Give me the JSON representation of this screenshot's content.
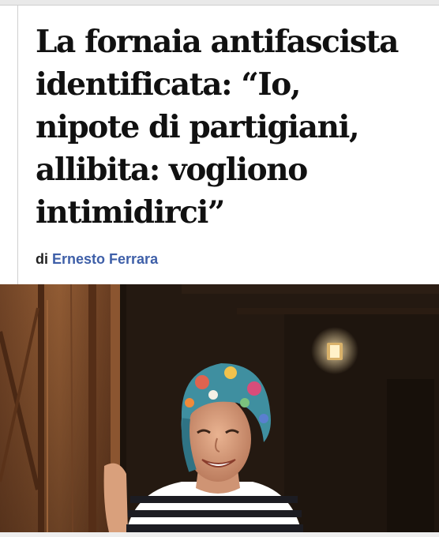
{
  "article": {
    "headline_lines": [
      "La fornaia antifascista",
      "identificata: “Io,",
      "nipote di partigiani,",
      "allibita: vogliono",
      "intimidirci”"
    ],
    "byline_prefix": "di",
    "author": "Ernesto Ferrara"
  },
  "photo": {
    "subject": "woman-with-headscarf-smiling-at-door"
  },
  "colors": {
    "author_link": "#3e5fa8",
    "headline": "#111111"
  }
}
